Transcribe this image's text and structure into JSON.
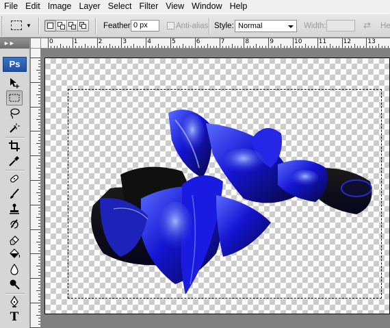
{
  "menubar": {
    "items": [
      "File",
      "Edit",
      "Image",
      "Layer",
      "Select",
      "Filter",
      "View",
      "Window",
      "Help"
    ]
  },
  "options": {
    "tool_icon": "rectangular-marquee-icon",
    "feather_label": "Feather:",
    "feather_value": "0 px",
    "antialias_label": "Anti-alias",
    "style_label": "Style:",
    "style_value": "Normal",
    "width_label": "Width:",
    "height_label": "He"
  },
  "toolbox": {
    "logo": "Ps",
    "tools": [
      "move-tool-icon",
      "rectangular-marquee-tool-icon",
      "lasso-tool-icon",
      "magic-wand-tool-icon",
      "crop-tool-icon",
      "eyedropper-tool-icon",
      "healing-brush-tool-icon",
      "brush-tool-icon",
      "clone-stamp-tool-icon",
      "history-brush-tool-icon",
      "eraser-tool-icon",
      "paint-bucket-tool-icon",
      "blur-tool-icon",
      "dodge-tool-icon",
      "pen-tool-icon",
      "type-tool-icon"
    ],
    "text_tool_glyph": "T"
  },
  "ruler": {
    "labels": [
      "0",
      "1",
      "2",
      "3",
      "4",
      "5",
      "6",
      "7",
      "8",
      "9",
      "10",
      "11",
      "12",
      "13"
    ]
  },
  "colors": {
    "artwork_primary": "#1a1ad6",
    "artwork_dark": "#0a0a3a",
    "ps_logo_bg": "#2a5fb4"
  }
}
